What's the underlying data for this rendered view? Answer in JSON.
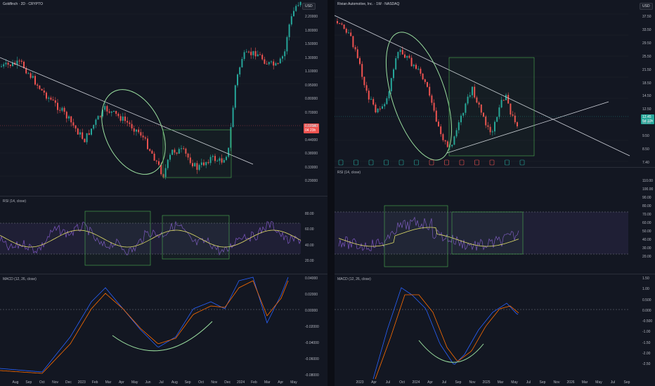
{
  "colors": {
    "background": "#131722",
    "up": "#26a69a",
    "down": "#ef5350",
    "trend": "#d1d4dc",
    "rsi_line": "#7e57c2",
    "rsi_ma": "#e8e16a",
    "macd": "#2962ff",
    "signal": "#ff6d00",
    "box": "#4caf50",
    "rsi_band": "#7e57c2",
    "price_tag_left": "#ef5350",
    "price_tag_right": "#26a69a"
  },
  "left": {
    "title": "Goldfinch · 2D · CRYPTO",
    "currency": "USD",
    "price_axis": [
      "2.20000",
      "1.80000",
      "1.50000",
      "1.30000",
      "1.10000",
      "0.95000",
      "0.80000",
      "0.70000",
      "0.60000",
      "0.44000",
      "0.38000",
      "0.33000",
      "0.29000"
    ],
    "price_tag": {
      "value": "0.57140",
      "sub": "04 23h"
    },
    "rsi": {
      "label": "RSI (14, close)",
      "axis": [
        "80.00",
        "60.00",
        "40.00",
        "20.00"
      ]
    },
    "macd": {
      "label": "MACD (12, 26, close)",
      "axis": [
        "0.04000",
        "0.02000",
        "0.00000",
        "-0.02000",
        "-0.04000",
        "-0.06000",
        "-0.08000"
      ]
    },
    "time_axis": [
      "Aug",
      "Sep",
      "Oct",
      "Nov",
      "Dec",
      "2023",
      "Feb",
      "Mar",
      "Apr",
      "May",
      "Jun",
      "Jul",
      "Aug",
      "Sep",
      "Oct",
      "Nov",
      "Dec",
      "2024",
      "Feb",
      "Mar",
      "Apr",
      "May"
    ]
  },
  "right": {
    "title": "Rivian Automotive, Inc. · 1W · NASDAQ",
    "currency": "USD",
    "price_axis": [
      "37.50",
      "33.50",
      "29.50",
      "25.50",
      "21.50",
      "18.50",
      "14.50",
      "12.50",
      "11.00",
      "9.50",
      "8.50",
      "7.40"
    ],
    "price_tag": {
      "value": "12.45",
      "sub": "5d 10h"
    },
    "rsi": {
      "label": "RSI (14, close)",
      "axis": [
        "110.00",
        "100.00",
        "90.00",
        "80.00",
        "70.00",
        "60.00",
        "50.00",
        "40.00",
        "30.00",
        "20.00"
      ]
    },
    "macd": {
      "label": "MACD (12, 26, close)",
      "axis": [
        "1.50",
        "1.00",
        "0.500",
        "0.000",
        "-0.500",
        "-1.00",
        "-1.50",
        "-2.00",
        "-2.50"
      ]
    },
    "time_axis": [
      "2023",
      "Apr",
      "Jul",
      "Oct",
      "2024",
      "Apr",
      "Jul",
      "Sep",
      "Nov",
      "2025",
      "Mar",
      "May",
      "Jul",
      "Sep",
      "Nov",
      "2026",
      "Mar",
      "May",
      "Jul",
      "Sep"
    ],
    "event_markers": [
      "E",
      "E",
      "E",
      "E",
      "E",
      "E",
      "E",
      "E",
      "E",
      "E",
      "D",
      "E",
      "E"
    ]
  }
}
